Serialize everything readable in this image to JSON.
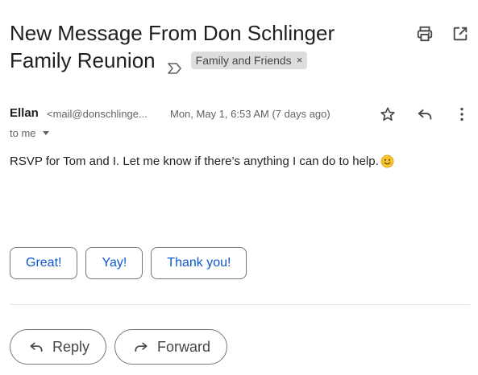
{
  "subject": {
    "line1": "New Message From Don Schlinger",
    "line2": "Family Reunion",
    "importance_icon": "importance-marker-icon",
    "label": "Family and Friends",
    "label_remove": "×"
  },
  "header_icons": [
    "print-icon",
    "open-in-new-window-icon"
  ],
  "message": {
    "sender_name": "Ellan",
    "sender_email": "<mail@donschlinge...",
    "date": "Mon, May 1, 6:53 AM (7 days ago)",
    "recipient": "to me",
    "row_icons": [
      "star-icon",
      "reply-icon",
      "more-options-icon"
    ],
    "body": "RSVP for Tom and I. Let me know if there’s anything I can do to help."
  },
  "smart_replies": [
    "Great!",
    "Yay!",
    "Thank you!"
  ],
  "actions": {
    "reply": "Reply",
    "forward": "Forward"
  },
  "colors": {
    "link_blue": "#0b57d0",
    "chip_bg": "#dddddd",
    "icon_gray": "#444746"
  }
}
